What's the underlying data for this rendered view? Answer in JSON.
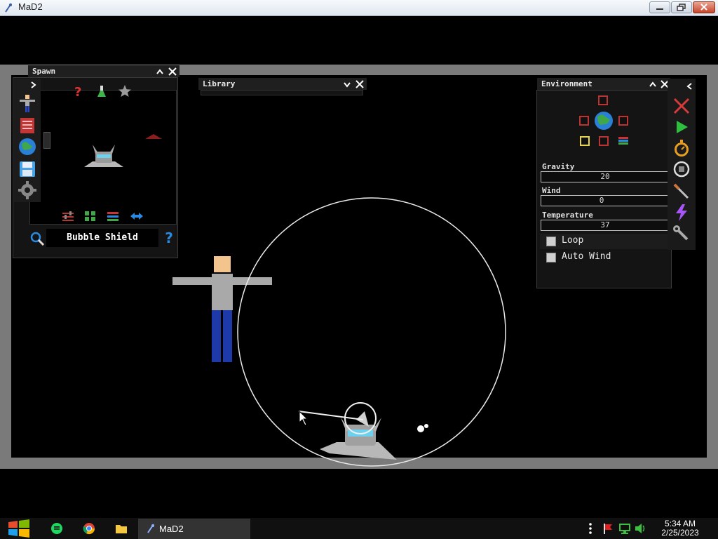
{
  "window": {
    "title": "MaD2"
  },
  "spawn_panel": {
    "title": "Spawn",
    "selected_item": "Bubble Shield",
    "help_glyph": "?"
  },
  "library_panel": {
    "title": "Library"
  },
  "environment_panel": {
    "title": "Environment",
    "fields": [
      {
        "label": "Gravity",
        "value": "20"
      },
      {
        "label": "Wind",
        "value": "0"
      },
      {
        "label": "Temperature",
        "value": "37"
      }
    ],
    "checkboxes": [
      {
        "label": "Loop",
        "checked": false
      },
      {
        "label": "Auto Wind",
        "checked": false
      }
    ]
  },
  "taskbar": {
    "app_label": "MaD2",
    "time": "5:34 AM",
    "date": "2/25/2023"
  },
  "colors": {
    "accent_blue": "#3b8fe0",
    "close_red": "#d83a3a",
    "play_green": "#2fbf3f",
    "panel_bg": "#141414"
  }
}
